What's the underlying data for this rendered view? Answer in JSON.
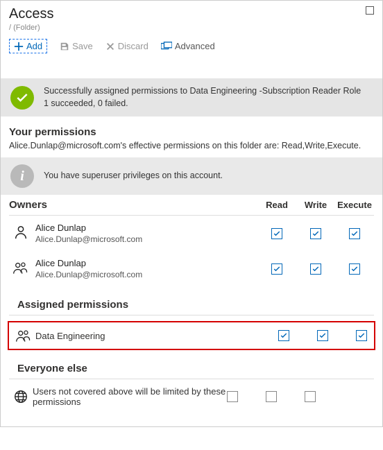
{
  "header": {
    "title": "Access",
    "breadcrumb": "/ (Folder)"
  },
  "toolbar": {
    "add": "Add",
    "save": "Save",
    "discard": "Discard",
    "advanced": "Advanced"
  },
  "success_banner": {
    "line1": "Successfully assigned permissions to Data Engineering -Subscription Reader Role",
    "line2": "1 succeeded, 0 failed."
  },
  "your_permissions": {
    "title": "Your permissions",
    "desc": "Alice.Dunlap@microsoft.com's effective permissions on this folder are: Read,Write,Execute."
  },
  "info_banner": {
    "text": "You have superuser privileges on this account."
  },
  "columns": {
    "owners": "Owners",
    "read": "Read",
    "write": "Write",
    "execute": "Execute"
  },
  "owners": [
    {
      "name": "Alice Dunlap",
      "email": "Alice.Dunlap@microsoft.com",
      "icon": "person",
      "read": true,
      "write": true,
      "execute": true
    },
    {
      "name": "Alice Dunlap",
      "email": "Alice.Dunlap@microsoft.com",
      "icon": "group",
      "read": true,
      "write": true,
      "execute": true
    }
  ],
  "assigned": {
    "title": "Assigned permissions",
    "items": [
      {
        "name": "Data Engineering",
        "icon": "group",
        "read": true,
        "write": true,
        "execute": true,
        "highlighted": true
      }
    ]
  },
  "everyone": {
    "title": "Everyone else",
    "desc": "Users not covered above will be limited by these permissions",
    "read": false,
    "write": false,
    "execute": false
  }
}
